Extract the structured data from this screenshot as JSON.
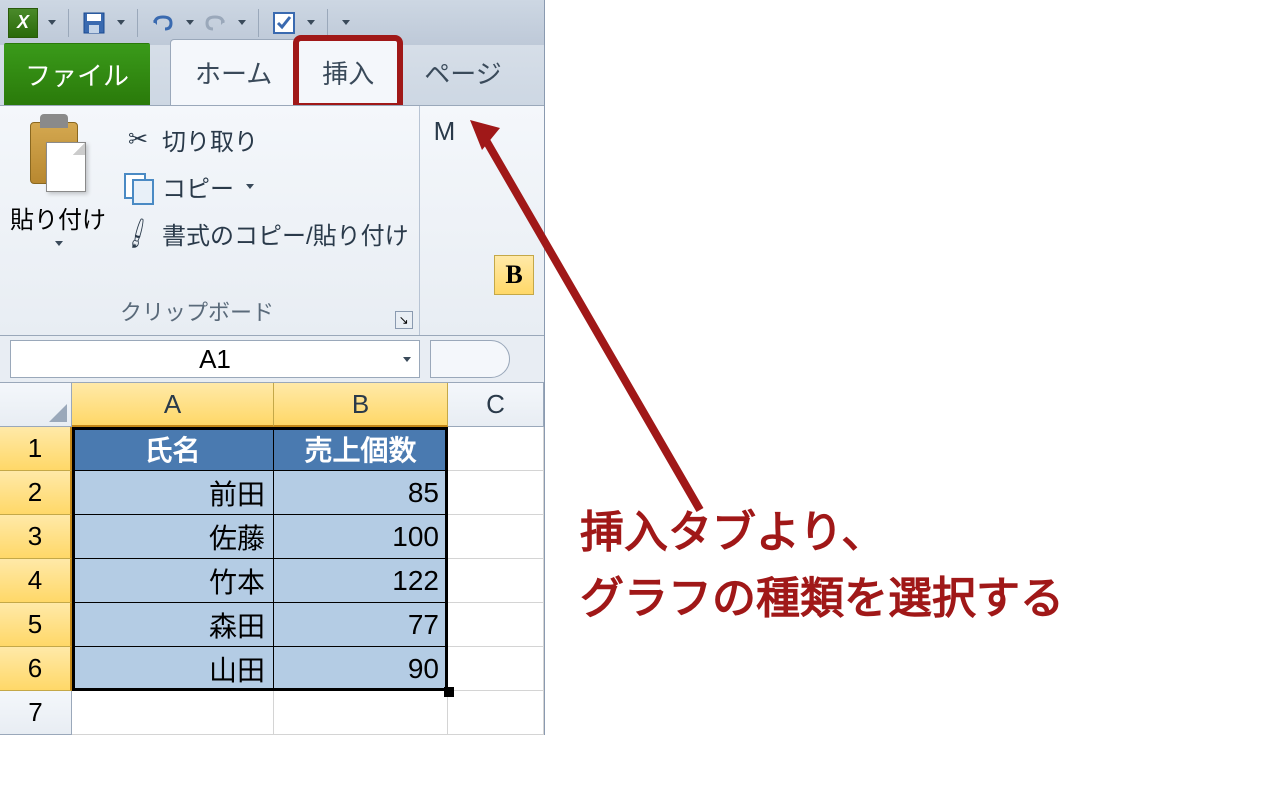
{
  "qat": {
    "cell_ref": "A1"
  },
  "tabs": {
    "file": "ファイル",
    "home": "ホーム",
    "insert": "挿入",
    "page": "ページ"
  },
  "ribbon": {
    "paste": "貼り付け",
    "cut": "切り取り",
    "copy": "コピー",
    "format_painter": "書式のコピー/貼り付け",
    "clipboard_group": "クリップボード",
    "font_fragment": "M",
    "bold": "B"
  },
  "columns": {
    "A": "A",
    "B": "B",
    "C": "C"
  },
  "rows": [
    "1",
    "2",
    "3",
    "4",
    "5",
    "6",
    "7"
  ],
  "data": {
    "header_name": "氏名",
    "header_qty": "売上個数",
    "rows": [
      {
        "name": "前田",
        "qty": "85"
      },
      {
        "name": "佐藤",
        "qty": "100"
      },
      {
        "name": "竹本",
        "qty": "122"
      },
      {
        "name": "森田",
        "qty": "77"
      },
      {
        "name": "山田",
        "qty": "90"
      }
    ]
  },
  "annotation": {
    "line1": "挿入タブより、",
    "line2": "グラフの種類を選択する"
  }
}
